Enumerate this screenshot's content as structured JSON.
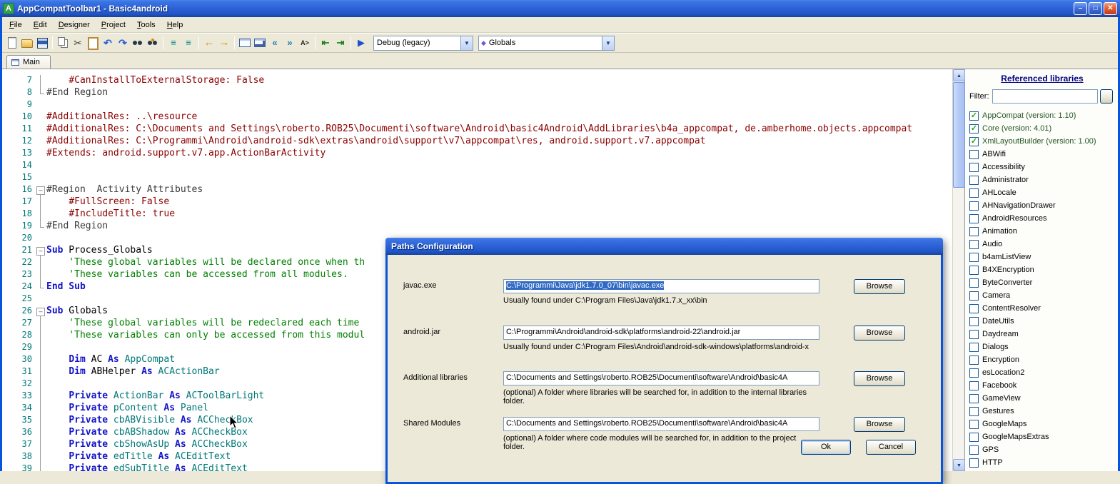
{
  "window": {
    "title": "AppCompatToolbar1 - Basic4android",
    "app_icon_text": "A"
  },
  "menu": {
    "items": [
      "File",
      "Edit",
      "Designer",
      "Project",
      "Tools",
      "Help"
    ]
  },
  "toolbar": {
    "items": [
      {
        "type": "icon",
        "name": "new-file-icon",
        "kind": "new"
      },
      {
        "type": "icon",
        "name": "open-project-icon",
        "kind": "open"
      },
      {
        "type": "icon",
        "name": "save-icon",
        "kind": "save"
      },
      {
        "type": "sep"
      },
      {
        "type": "icon",
        "name": "copy-icon",
        "kind": "copy"
      },
      {
        "type": "icon",
        "name": "cut-icon",
        "kind": "cut",
        "glyph": "✂"
      },
      {
        "type": "icon",
        "name": "paste-icon",
        "kind": "paste"
      },
      {
        "type": "icon",
        "name": "undo-icon",
        "kind": "undo",
        "glyph": "↶"
      },
      {
        "type": "icon",
        "name": "redo-icon",
        "kind": "redo",
        "glyph": "↷"
      },
      {
        "type": "icon",
        "name": "find-icon",
        "kind": "find"
      },
      {
        "type": "icon",
        "name": "find-replace-icon",
        "kind": "find2"
      },
      {
        "type": "sep"
      },
      {
        "type": "icon",
        "name": "comment-icon",
        "kind": "cmt",
        "glyph": "≡"
      },
      {
        "type": "icon",
        "name": "uncomment-icon",
        "kind": "cmt2",
        "glyph": "≡"
      },
      {
        "type": "sep"
      },
      {
        "type": "icon",
        "name": "nav-back-icon",
        "kind": "navback",
        "glyph": "←"
      },
      {
        "type": "icon",
        "name": "nav-forward-icon",
        "kind": "navfwd",
        "glyph": "→"
      },
      {
        "type": "sep"
      },
      {
        "type": "icon",
        "name": "designer-icon",
        "kind": "rect"
      },
      {
        "type": "icon",
        "name": "designer-view-icon",
        "kind": "rect2"
      },
      {
        "type": "icon",
        "name": "prev-sub-icon",
        "kind": "bubbleback",
        "glyph": "«"
      },
      {
        "type": "icon",
        "name": "next-sub-icon",
        "kind": "bubblefwd",
        "glyph": "»"
      },
      {
        "type": "icon",
        "name": "autocomplete-icon",
        "kind": "az",
        "glyph": "A>"
      },
      {
        "type": "sep"
      },
      {
        "type": "icon",
        "name": "outdent-icon",
        "kind": "outdent",
        "glyph": "⇤"
      },
      {
        "type": "icon",
        "name": "indent-icon",
        "kind": "indent",
        "glyph": "⇥"
      },
      {
        "type": "sep"
      },
      {
        "type": "icon",
        "name": "run-icon",
        "kind": "run",
        "glyph": "▶"
      },
      {
        "type": "combo",
        "name": "build-configuration-combo",
        "value": "Debug (legacy)",
        "width": 140
      },
      {
        "type": "combo",
        "name": "module-combo",
        "value": "Globals",
        "width": 191,
        "icon": "◆"
      }
    ]
  },
  "tabs": {
    "main_label": "Main"
  },
  "editor": {
    "lines": [
      {
        "n": 7,
        "f": "line",
        "s": [
          [
            "p",
            "    "
          ],
          [
            "d",
            "#CanInstallToExternalStorage: False"
          ]
        ]
      },
      {
        "n": 8,
        "f": "end",
        "s": [
          [
            "r",
            "#End Region"
          ]
        ]
      },
      {
        "n": 9,
        "f": "",
        "s": []
      },
      {
        "n": 10,
        "f": "",
        "s": [
          [
            "d",
            "#AdditionalRes: ..\\resource"
          ]
        ]
      },
      {
        "n": 11,
        "f": "",
        "s": [
          [
            "d",
            "#AdditionalRes: C:\\Documents and Settings\\roberto.ROB25\\Documenti\\software\\Android\\basic4Android\\AddLibraries\\b4a_appcompat, de.amberhome.objects.appcompat"
          ]
        ]
      },
      {
        "n": 12,
        "f": "",
        "s": [
          [
            "d",
            "#AdditionalRes: C:\\Programmi\\Android\\android-sdk\\extras\\android\\support\\v7\\appcompat\\res, android.support.v7.appcompat"
          ]
        ]
      },
      {
        "n": 13,
        "f": "",
        "s": [
          [
            "d",
            "#Extends: android.support.v7.app.ActionBarActivity"
          ]
        ]
      },
      {
        "n": 14,
        "f": "",
        "s": []
      },
      {
        "n": 15,
        "f": "",
        "s": []
      },
      {
        "n": 16,
        "f": "box",
        "s": [
          [
            "r",
            "#Region  Activity Attributes"
          ]
        ]
      },
      {
        "n": 17,
        "f": "line",
        "s": [
          [
            "p",
            "    "
          ],
          [
            "d",
            "#FullScreen: False"
          ]
        ]
      },
      {
        "n": 18,
        "f": "line",
        "s": [
          [
            "p",
            "    "
          ],
          [
            "d",
            "#IncludeTitle: true"
          ]
        ]
      },
      {
        "n": 19,
        "f": "end",
        "s": [
          [
            "r",
            "#End Region"
          ]
        ]
      },
      {
        "n": 20,
        "f": "",
        "s": []
      },
      {
        "n": 21,
        "f": "box",
        "s": [
          [
            "k",
            "Sub"
          ],
          [
            "p",
            " Process_Globals"
          ]
        ]
      },
      {
        "n": 22,
        "f": "line",
        "s": [
          [
            "c",
            "    'These global variables will be declared once when th"
          ]
        ]
      },
      {
        "n": 23,
        "f": "line",
        "s": [
          [
            "c",
            "    'These variables can be accessed from all modules."
          ]
        ]
      },
      {
        "n": 24,
        "f": "end",
        "s": [
          [
            "k",
            "End Sub"
          ]
        ]
      },
      {
        "n": 25,
        "f": "",
        "s": []
      },
      {
        "n": 26,
        "f": "box",
        "s": [
          [
            "k",
            "Sub"
          ],
          [
            "p",
            " Globals"
          ]
        ]
      },
      {
        "n": 27,
        "f": "line",
        "s": [
          [
            "c",
            "    'These global variables will be redeclared each time"
          ]
        ]
      },
      {
        "n": 28,
        "f": "line",
        "s": [
          [
            "c",
            "    'These variables can only be accessed from this modul"
          ]
        ]
      },
      {
        "n": 29,
        "f": "line",
        "s": []
      },
      {
        "n": 30,
        "f": "line",
        "s": [
          [
            "p",
            "    "
          ],
          [
            "k",
            "Dim"
          ],
          [
            "p",
            " AC "
          ],
          [
            "k",
            "As"
          ],
          [
            "t",
            " AppCompat"
          ]
        ]
      },
      {
        "n": 31,
        "f": "line",
        "s": [
          [
            "p",
            "    "
          ],
          [
            "k",
            "Dim"
          ],
          [
            "p",
            " ABHelper "
          ],
          [
            "k",
            "As"
          ],
          [
            "t",
            " ACActionBar"
          ]
        ]
      },
      {
        "n": 32,
        "f": "line",
        "s": []
      },
      {
        "n": 33,
        "f": "line",
        "s": [
          [
            "p",
            "    "
          ],
          [
            "k",
            "Private"
          ],
          [
            "t",
            " ActionBar "
          ],
          [
            "k",
            "As"
          ],
          [
            "t",
            " ACToolBarLight"
          ]
        ]
      },
      {
        "n": 34,
        "f": "line",
        "s": [
          [
            "p",
            "    "
          ],
          [
            "k",
            "Private"
          ],
          [
            "t",
            " pContent "
          ],
          [
            "k",
            "As"
          ],
          [
            "t",
            " Panel"
          ]
        ]
      },
      {
        "n": 35,
        "f": "line",
        "s": [
          [
            "p",
            "    "
          ],
          [
            "k",
            "Private"
          ],
          [
            "t",
            " cbABVisible "
          ],
          [
            "k",
            "As"
          ],
          [
            "t",
            " ACCheckBox"
          ]
        ]
      },
      {
        "n": 36,
        "f": "line",
        "s": [
          [
            "p",
            "    "
          ],
          [
            "k",
            "Private"
          ],
          [
            "t",
            " cbABShadow "
          ],
          [
            "k",
            "As"
          ],
          [
            "t",
            " ACCheckBox"
          ]
        ]
      },
      {
        "n": 37,
        "f": "line",
        "s": [
          [
            "p",
            "    "
          ],
          [
            "k",
            "Private"
          ],
          [
            "t",
            " cbShowAsUp "
          ],
          [
            "k",
            "As"
          ],
          [
            "t",
            " ACCheckBox"
          ]
        ]
      },
      {
        "n": 38,
        "f": "line",
        "s": [
          [
            "p",
            "    "
          ],
          [
            "k",
            "Private"
          ],
          [
            "t",
            " edTitle "
          ],
          [
            "k",
            "As"
          ],
          [
            "t",
            " ACEditText"
          ]
        ]
      },
      {
        "n": 39,
        "f": "line",
        "s": [
          [
            "p",
            "    "
          ],
          [
            "k",
            "Private"
          ],
          [
            "t",
            " edSubTitle "
          ],
          [
            "k",
            "As"
          ],
          [
            "t",
            " ACEditText"
          ]
        ]
      }
    ]
  },
  "dialog": {
    "title": "Paths Configuration",
    "rows": [
      {
        "label": "javac.exe",
        "value": "C:\\Programmi\\Java\\jdk1.7.0_07\\bin\\javac.exe",
        "hint": "Usually found under C:\\Program Files\\Java\\jdk1.7.x_xx\\bin",
        "browse": "Browse",
        "selected": true
      },
      {
        "label": "android.jar",
        "value": "C:\\Programmi\\Android\\android-sdk\\platforms\\android-22\\android.jar",
        "hint": "Usually found under C:\\Program Files\\Android\\android-sdk-windows\\platforms\\android-x",
        "browse": "Browse",
        "selected": false
      },
      {
        "label": "Additional libraries",
        "value": "C:\\Documents and Settings\\roberto.ROB25\\Documenti\\software\\Android\\basic4A",
        "hint": "(optional) A folder where libraries will be searched for, in addition to the internal libraries folder.",
        "browse": "Browse",
        "selected": false
      },
      {
        "label": "Shared Modules",
        "value": "C:\\Documents and Settings\\roberto.ROB25\\Documenti\\software\\Android\\basic4A",
        "hint": "(optional) A folder where code modules will be searched for, in addition to the project folder.",
        "browse": "Browse",
        "selected": false
      }
    ],
    "ok_label": "Ok",
    "cancel_label": "Cancel"
  },
  "libraries": {
    "title": "Referenced libraries",
    "filter_label": "Filter:",
    "filter_value": "",
    "items": [
      {
        "label": "AppCompat (version: 1.10)",
        "checked": true
      },
      {
        "label": "Core (version: 4.01)",
        "checked": true
      },
      {
        "label": "XmlLayoutBuilder (version: 1.00)",
        "checked": true
      },
      {
        "label": "ABWifi",
        "checked": false
      },
      {
        "label": "Accessibility",
        "checked": false
      },
      {
        "label": "Administrator",
        "checked": false
      },
      {
        "label": "AHLocale",
        "checked": false
      },
      {
        "label": "AHNavigationDrawer",
        "checked": false
      },
      {
        "label": "AndroidResources",
        "checked": false
      },
      {
        "label": "Animation",
        "checked": false
      },
      {
        "label": "Audio",
        "checked": false
      },
      {
        "label": "b4amListView",
        "checked": false
      },
      {
        "label": "B4XEncryption",
        "checked": false
      },
      {
        "label": "ByteConverter",
        "checked": false
      },
      {
        "label": "Camera",
        "checked": false
      },
      {
        "label": "ContentResolver",
        "checked": false
      },
      {
        "label": "DateUtils",
        "checked": false
      },
      {
        "label": "Daydream",
        "checked": false
      },
      {
        "label": "Dialogs",
        "checked": false
      },
      {
        "label": "Encryption",
        "checked": false
      },
      {
        "label": "esLocation2",
        "checked": false
      },
      {
        "label": "Facebook",
        "checked": false
      },
      {
        "label": "GameView",
        "checked": false
      },
      {
        "label": "Gestures",
        "checked": false
      },
      {
        "label": "GoogleMaps",
        "checked": false
      },
      {
        "label": "GoogleMapsExtras",
        "checked": false
      },
      {
        "label": "GPS",
        "checked": false
      },
      {
        "label": "HTTP",
        "checked": false
      }
    ]
  },
  "colors": {
    "titlebar_blue": "#2E63D8",
    "selection_blue": "#316AC5",
    "directive_red": "#8B0000",
    "keyword_blue": "#1414C8",
    "type_teal": "#007878",
    "comment_green": "#007F00"
  }
}
